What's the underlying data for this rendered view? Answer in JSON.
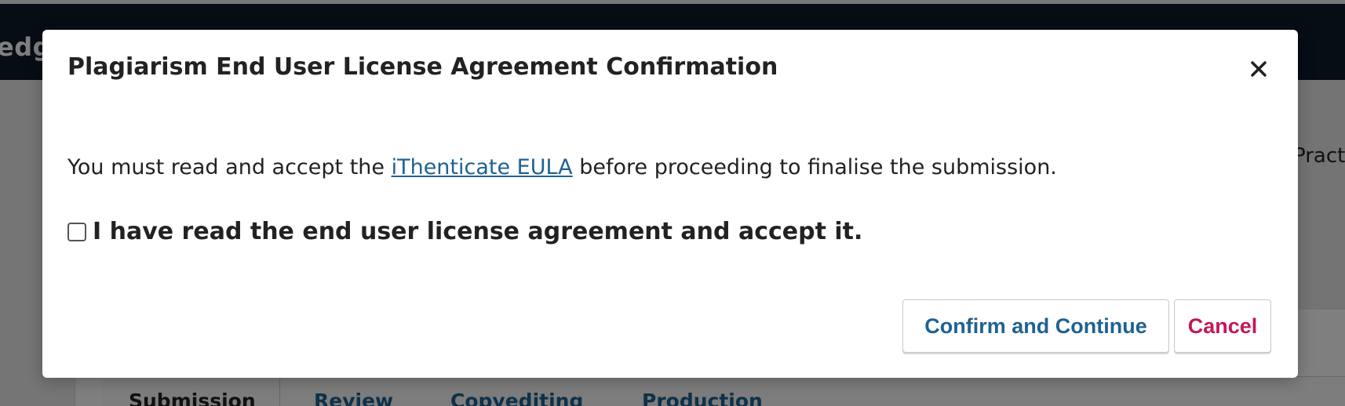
{
  "background": {
    "brand_fragment": "edge",
    "side_text_fragment": "Pract",
    "tabs": [
      "Submission",
      "Review",
      "Copyediting",
      "Production"
    ]
  },
  "modal": {
    "title": "Plagiarism End User License Agreement Confirmation",
    "close_icon": "close-icon",
    "body_prefix": "You must read and accept the ",
    "eula_link": "iThenticate EULA",
    "body_suffix": " before proceeding to finalise the submission.",
    "checkbox_label": "I have read the end user license agreement and accept it.",
    "checkbox_checked": false,
    "confirm_label": "Confirm and Continue",
    "cancel_label": "Cancel"
  },
  "colors": {
    "header": "#0d1b2b",
    "link": "#1e6292",
    "cancel": "#c2185b",
    "overlay": "rgba(0,0,0,0.5)"
  }
}
